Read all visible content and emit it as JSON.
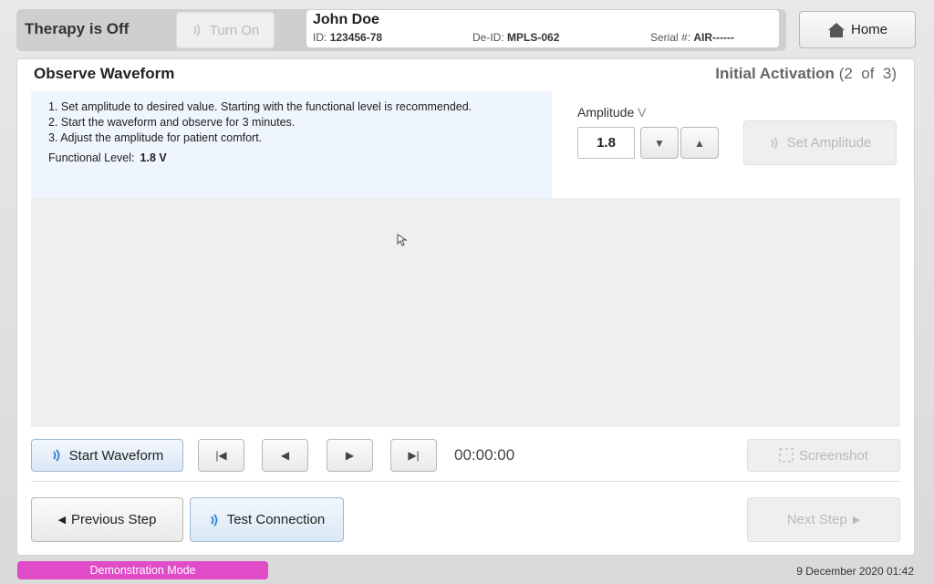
{
  "header": {
    "therapy_status": "Therapy is Off",
    "turn_on_label": "Turn On",
    "home_label": "Home"
  },
  "patient": {
    "name": "John Doe",
    "id_label": "ID:",
    "id_value": "123456-78",
    "deid_label": "De-ID:",
    "deid_value": "MPLS-062",
    "serial_label": "Serial #:",
    "serial_value": "AIR------"
  },
  "page": {
    "title": "Observe Waveform",
    "step_name": "Initial Activation",
    "step_progress": "(2  of  3)"
  },
  "instructions": {
    "steps": [
      "1. Set amplitude to desired value. Starting with the functional level is recommended.",
      "2. Start the waveform and observe for 3 minutes.",
      "3. Adjust the amplitude for patient comfort."
    ],
    "functional_label": "Functional Level:",
    "functional_value": "1.8 V"
  },
  "amplitude": {
    "label": "Amplitude",
    "unit": "V",
    "value": "1.8",
    "set_label": "Set Amplitude"
  },
  "controls": {
    "start_waveform_label": "Start Waveform",
    "timer": "00:00:00",
    "screenshot_label": "Screenshot"
  },
  "footer_nav": {
    "previous_label": "Previous Step",
    "test_connection_label": "Test Connection",
    "next_label": "Next Step"
  },
  "status": {
    "mode": "Demonstration Mode",
    "datetime": "9 December 2020 01:42"
  },
  "colors": {
    "accent_blue": "#2d7fd0",
    "demo_pink": "#e04bc8",
    "instruction_bg": "#eef5fc"
  }
}
